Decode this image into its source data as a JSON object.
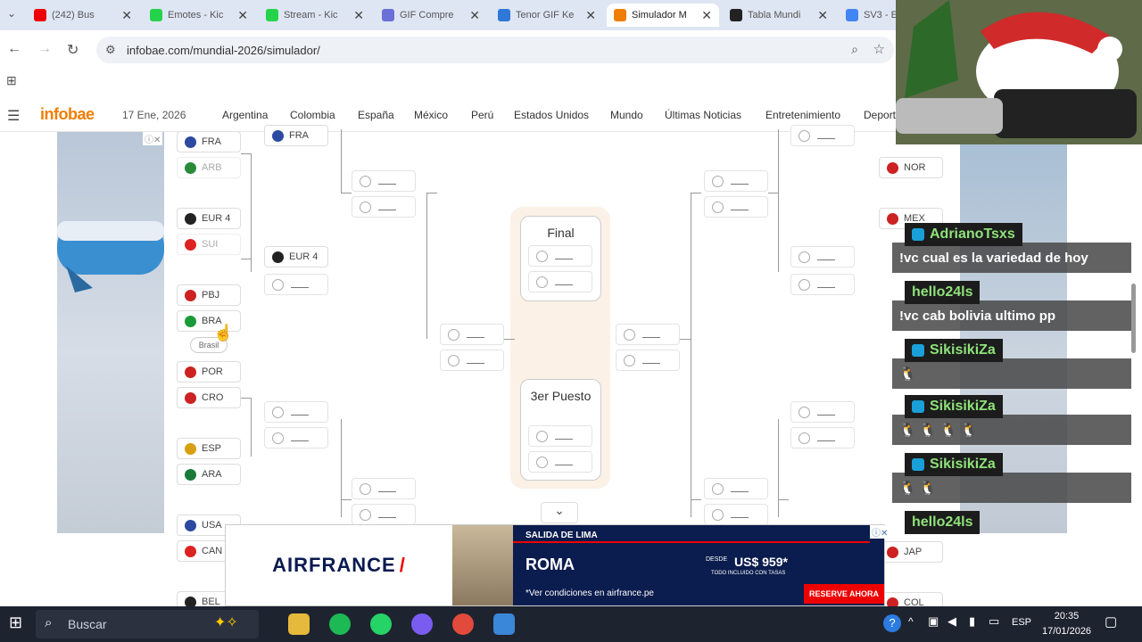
{
  "browser": {
    "tabs": [
      {
        "title": "(242) Bus",
        "color": "#e00",
        "active": false
      },
      {
        "title": "Emotes - Kic",
        "color": "#25d34a",
        "active": false
      },
      {
        "title": "Stream - Kic",
        "color": "#25d34a",
        "active": false
      },
      {
        "title": "GIF Compre",
        "color": "#6b6fd8",
        "active": false
      },
      {
        "title": "Tenor GIF Ke",
        "color": "#2f77d9",
        "active": false
      },
      {
        "title": "Simulador M",
        "color": "#f07d00",
        "active": true
      },
      {
        "title": "Tabla Mundi",
        "color": "#222",
        "active": false
      },
      {
        "title": "SV3 - E",
        "color": "#4285f4",
        "active": false
      }
    ],
    "url": "infobae.com/mundial-2026/simulador/"
  },
  "site": {
    "logo": "infobae",
    "date": "17 Ene, 2026",
    "nav": [
      "Argentina",
      "Colombia",
      "España",
      "México",
      "Perú",
      "Estados Unidos",
      "Mundo",
      "Últimas Noticias",
      "Entretenimiento",
      "Deport"
    ]
  },
  "bracket": {
    "left_r1": [
      {
        "code": "FRA",
        "faded": false,
        "flag": "#2b4aa0"
      },
      {
        "code": "ARB",
        "faded": true,
        "flag": "#2a8a3a"
      },
      {
        "code": "EUR 4",
        "faded": false,
        "flag": "#222"
      },
      {
        "code": "SUI",
        "faded": true,
        "flag": "#d22"
      },
      {
        "code": "PBJ",
        "faded": false,
        "flag": "#c22"
      },
      {
        "code": "BRA",
        "faded": false,
        "flag": "#1a9a3a"
      },
      {
        "code": "POR",
        "faded": false,
        "flag": "#c22"
      },
      {
        "code": "CRO",
        "faded": false,
        "flag": "#c22"
      },
      {
        "code": "ESP",
        "faded": false,
        "flag": "#d8a010"
      },
      {
        "code": "ARA",
        "faded": false,
        "flag": "#1a7a3a"
      },
      {
        "code": "USA",
        "faded": false,
        "flag": "#2b4aa0"
      },
      {
        "code": "CAN",
        "faded": false,
        "flag": "#d22"
      },
      {
        "code": "BEL",
        "faded": false,
        "flag": "#222"
      }
    ],
    "left_r2_top": "FRA",
    "left_r2_mid": "EUR 4",
    "tooltip": "Brasil",
    "right_r1": [
      "NOR",
      "MEX",
      "JAP",
      "COL"
    ],
    "final_label": "Final",
    "third_label": "3er Puesto"
  },
  "ad": {
    "brand": "AIRFRANCE",
    "top": "SALIDA DE LIMA",
    "city": "ROMA",
    "desde": "DESDE",
    "price": "US$ 959*",
    "fine": "TODO INCLUIDO CON TASAS",
    "note": "*Ver condiciones en airfrance.pe",
    "cta": "RESERVE AHORA"
  },
  "chat": [
    {
      "user": "AdrianoTsxs",
      "msg": "!vc cual es la variedad de hoy"
    },
    {
      "user": "hello24ls",
      "msg": "!vc cab bolivia ultimo pp"
    },
    {
      "user": "SikisikiZa",
      "msg": "🐧"
    },
    {
      "user": "SikisikiZa",
      "msg": "🐧 🐧 🐧 🐧"
    },
    {
      "user": "SikisikiZa",
      "msg": "🐧 🐧"
    },
    {
      "user": "hello24ls",
      "msg": ""
    }
  ],
  "taskbar": {
    "search": "Buscar",
    "lang": "ESP",
    "time": "20:35",
    "date": "17/01/2026"
  }
}
